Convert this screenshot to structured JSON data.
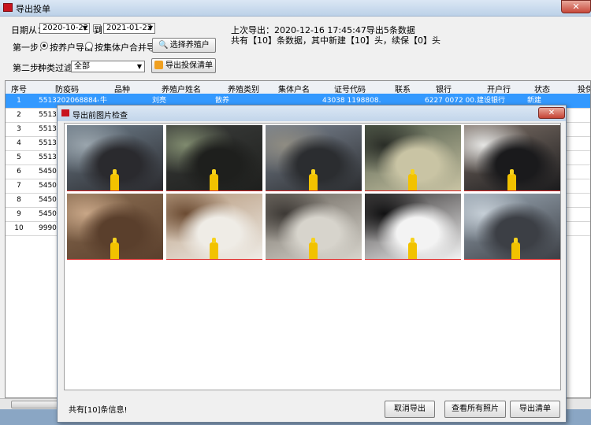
{
  "main_window": {
    "title": "导出投单",
    "close_glyph": "✕"
  },
  "filters": {
    "date_from_label": "日期从：",
    "date_from_value": "2020-10-22",
    "date_to_label": "到",
    "date_to_value": "2021-01-22",
    "last_export_text": "上次导出：2020-12-16 17:45:47导出5条数据",
    "summary_text": "共有【10】条数据，其中新建【10】头，续保【0】头",
    "step1_label": "第一步：",
    "radio_by_farmer": "按养户导出",
    "radio_by_collective": "按集体户合并导出",
    "choose_farmer_button": "选择养殖户",
    "step2_label": "第二步：",
    "category_filter_label": "种类过滤",
    "category_value": "全部",
    "export_list_button": "导出投保清单",
    "dropdown_glyph": "▼"
  },
  "grid": {
    "columns": [
      "序号",
      "防疫码",
      "品种",
      "养殖户姓名",
      "养殖类别",
      "集体户名",
      "证号代码",
      "联系",
      "银行",
      "开户行",
      "状态",
      "投保"
    ],
    "rows": [
      {
        "no": "1",
        "code": "5513202068884453",
        "breed": "牛",
        "farmer": "刘亮",
        "category": "散养",
        "collective": "",
        "id_code": "43038 1198808...",
        "contact": "",
        "bank": "6227 0072 00...",
        "branch": "建设银行",
        "status": "新建",
        "selected": true
      },
      {
        "no": "2",
        "code": "5513200...",
        "selected": false
      },
      {
        "no": "3",
        "code": "5513200...",
        "selected": false
      },
      {
        "no": "4",
        "code": "5513200...",
        "selected": false
      },
      {
        "no": "5",
        "code": "5513200...",
        "selected": false
      },
      {
        "no": "6",
        "code": "5450000...",
        "selected": false
      },
      {
        "no": "7",
        "code": "5450000...",
        "selected": false
      },
      {
        "no": "8",
        "code": "5450000...",
        "selected": false
      },
      {
        "no": "9",
        "code": "5450000...",
        "selected": false
      },
      {
        "no": "10",
        "code": "9990000...",
        "selected": false
      }
    ]
  },
  "dialog": {
    "title": "导出前图片检查",
    "close_glyph": "✕",
    "photos": [
      {
        "subject": "black-yak-eating",
        "colors": [
          "#6e7d8a",
          "#2a2a2e",
          "#9aa5ad"
        ]
      },
      {
        "subject": "black-yak-grass",
        "colors": [
          "#3a3c3a",
          "#1e1f1d",
          "#7f8a6e"
        ]
      },
      {
        "subject": "black-yak-stones",
        "colors": [
          "#7a8390",
          "#2b2d30",
          "#8f8c82"
        ]
      },
      {
        "subject": "white-horned-goat",
        "colors": [
          "#4f5a4a",
          "#c9c4a4",
          "#2a2d27"
        ]
      },
      {
        "subject": "black-white-cow",
        "colors": [
          "#7c6f66",
          "#1a1a1c",
          "#e5e5e3"
        ]
      },
      {
        "subject": "brown-cow-fur",
        "colors": [
          "#8a6d52",
          "#5a3f2c",
          "#c8a687"
        ]
      },
      {
        "subject": "brown-white-calf",
        "colors": [
          "#b79a7e",
          "#efece6",
          "#6c4c33"
        ]
      },
      {
        "subject": "white-goat-wall",
        "colors": [
          "#6e6860",
          "#d7d4cc",
          "#3d3935"
        ]
      },
      {
        "subject": "holstein-cow",
        "colors": [
          "#3b3838",
          "#f3f3f3",
          "#111112"
        ]
      },
      {
        "subject": "barn-with-man",
        "colors": [
          "#9aa7b3",
          "#3c3f45",
          "#c5ced6"
        ]
      }
    ],
    "footer_text": "共有[10]条信息!",
    "cancel_button": "取消导出",
    "view_all_button": "查看所有照片",
    "export_button": "导出清单"
  }
}
